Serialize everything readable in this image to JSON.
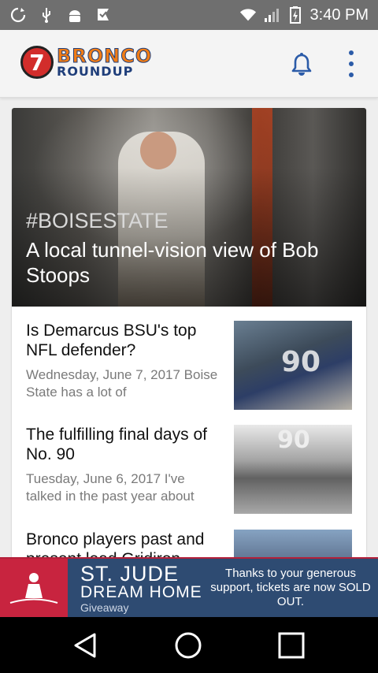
{
  "status_bar": {
    "time": "3:40 PM",
    "left_icons": [
      "sync-icon",
      "usb-icon",
      "android-debug-icon",
      "check-flag-icon"
    ],
    "right_icons": [
      "wifi-icon",
      "signal-icon",
      "battery-icon"
    ]
  },
  "app_bar": {
    "logo_number": "7",
    "logo_line1": "BRONCO",
    "logo_line2": "ROUNDUP",
    "notification_icon": "bell-icon",
    "overflow_icon": "more-vert-icon",
    "colors": {
      "logo_orange": "#f07c16",
      "logo_blue": "#1f3e7a",
      "logo_red": "#d22d2b"
    }
  },
  "feed": {
    "featured": {
      "tag": "#BOISESTATE",
      "title": "A local tunnel-vision view of Bob Stoops"
    },
    "articles": [
      {
        "title": "Is Demarcus BSU's top NFL defender?",
        "snippet": "Wednesday, June 7, 2017 Boise State has a lot of",
        "thumb_text": "90"
      },
      {
        "title": "The fulfilling final days of No. 90",
        "snippet": "Tuesday, June 6, 2017 I've talked in the past year about",
        "thumb_text": "90"
      },
      {
        "title": "Bronco players past and present lead Gridiron",
        "snippet": ""
      }
    ]
  },
  "ad": {
    "brand_line1": "ST. JUDE",
    "brand_line2": "DREAM HOME",
    "brand_line3": "Giveaway",
    "message": "Thanks to your generous support, tickets are now SOLD OUT.",
    "colors": {
      "background": "#2e4b72",
      "accent": "#c8243f"
    }
  },
  "nav_bar": {
    "back_icon": "back-icon",
    "home_icon": "home-icon",
    "recents_icon": "recents-icon"
  }
}
